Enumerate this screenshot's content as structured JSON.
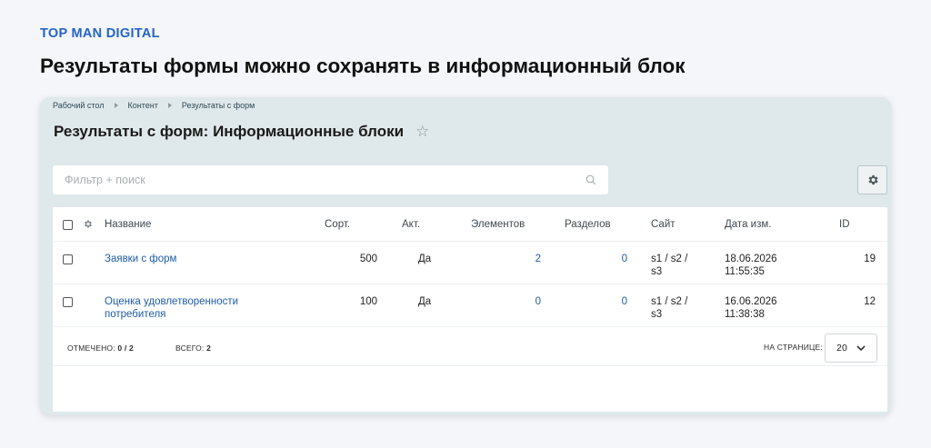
{
  "brand": "TOP MAN DIGITAL",
  "headline": "Результаты формы можно сохранять в информационный блок",
  "breadcrumb": [
    "Рабочий стол",
    "Контент",
    "Результаты с форм"
  ],
  "page_title": "Результаты с форм: Информационные блоки",
  "search": {
    "placeholder": "Фильтр + поиск"
  },
  "table": {
    "columns": {
      "name": "Название",
      "sort": "Сорт.",
      "active": "Акт.",
      "elements": "Элементов",
      "sections": "Разделов",
      "site": "Сайт",
      "date": "Дата изм.",
      "id": "ID"
    },
    "rows": [
      {
        "name": "Заявки с форм",
        "sort": "500",
        "active": "Да",
        "elements": "2",
        "sections": "0",
        "site_1": "s1 / s2 /",
        "site_2": "s3",
        "date_1": "18.06.2026",
        "date_2": "11:55:35",
        "id": "19"
      },
      {
        "name_1": "Оценка удовлетворенности",
        "name_2": "потребителя",
        "sort": "100",
        "active": "Да",
        "elements": "0",
        "sections": "0",
        "site_1": "s1 / s2 /",
        "site_2": "s3",
        "date_1": "16.06.2026",
        "date_2": "11:38:38",
        "id": "12"
      }
    ]
  },
  "footer": {
    "marked_label": "ОТМЕЧЕНО:",
    "marked_value": "0 / 2",
    "total_label": "ВСЕГО:",
    "total_value": "2",
    "per_page_label": "НА СТРАНИЦЕ:",
    "per_page_value": "20"
  },
  "icons": {
    "favorite": "star-outline-icon",
    "search": "search-icon",
    "settings": "gear-icon",
    "column_settings": "gear-icon",
    "dropdown": "chevron-down-icon",
    "breadcrumb_separator": "triangle-right-icon"
  },
  "colors": {
    "brand": "#2364c8",
    "link": "#1f5ca8",
    "window_bg": "#dfe8ea"
  }
}
